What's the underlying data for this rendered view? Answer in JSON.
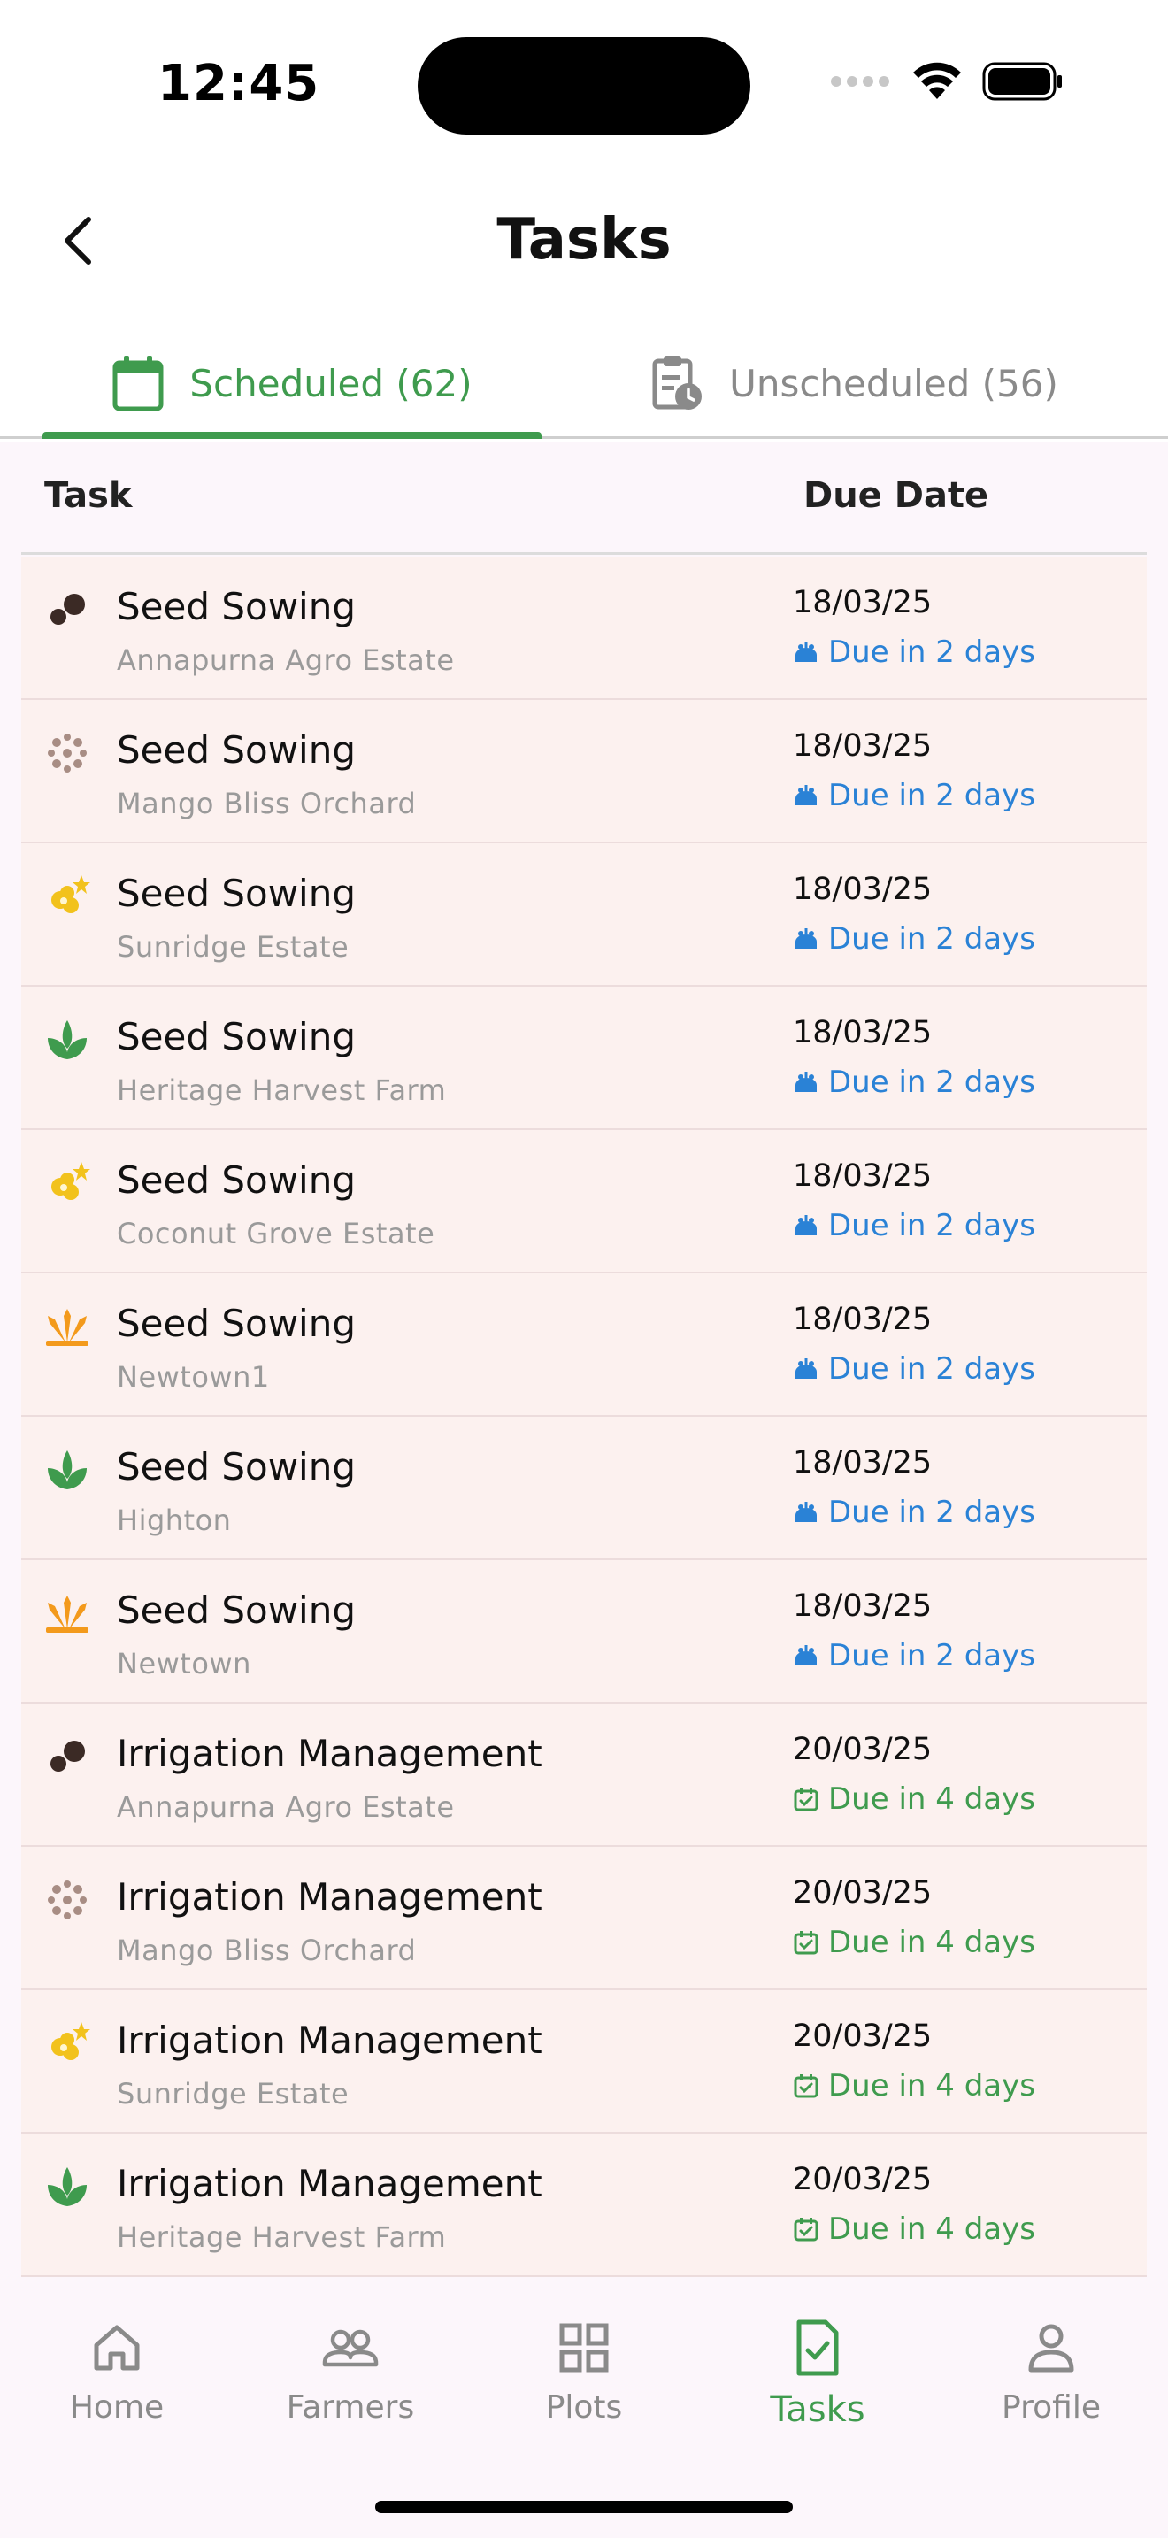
{
  "status_bar": {
    "time": "12:45"
  },
  "header": {
    "title": "Tasks"
  },
  "tabs": [
    {
      "label": "Scheduled (62)",
      "icon": "calendar-icon",
      "active": true
    },
    {
      "label": "Unscheduled (56)",
      "icon": "clipboard-clock-icon",
      "active": false
    }
  ],
  "table": {
    "col_task": "Task",
    "col_due": "Due Date",
    "rows": [
      {
        "task": "Seed Sowing",
        "farm": "Annapurna Agro Estate",
        "date": "18/03/25",
        "due": "Due in 2 days",
        "icon": "peas-icon",
        "due_icon": "sunrise-icon",
        "due_color": "#2a82d6"
      },
      {
        "task": "Seed Sowing",
        "farm": "Mango Bliss Orchard",
        "date": "18/03/25",
        "due": "Due in 2 days",
        "icon": "seeds-dots-icon",
        "due_icon": "sunrise-icon",
        "due_color": "#2a82d6"
      },
      {
        "task": "Seed Sowing",
        "farm": "Sunridge Estate",
        "date": "18/03/25",
        "due": "Due in 2 days",
        "icon": "yellow-flower-icon",
        "due_icon": "sunrise-icon",
        "due_color": "#2a82d6"
      },
      {
        "task": "Seed Sowing",
        "farm": "Heritage Harvest Farm",
        "date": "18/03/25",
        "due": "Due in 2 days",
        "icon": "green-leaf-icon",
        "due_icon": "sunrise-icon",
        "due_color": "#2a82d6"
      },
      {
        "task": "Seed Sowing",
        "farm": "Coconut Grove Estate",
        "date": "18/03/25",
        "due": "Due in 2 days",
        "icon": "yellow-flower-icon",
        "due_icon": "sunrise-icon",
        "due_color": "#2a82d6"
      },
      {
        "task": "Seed Sowing",
        "farm": "Newtown1",
        "date": "18/03/25",
        "due": "Due in 2 days",
        "icon": "wheat-sprout-icon",
        "due_icon": "sunrise-icon",
        "due_color": "#2a82d6"
      },
      {
        "task": "Seed Sowing",
        "farm": "Highton",
        "date": "18/03/25",
        "due": "Due in 2 days",
        "icon": "green-leaf-icon",
        "due_icon": "sunrise-icon",
        "due_color": "#2a82d6"
      },
      {
        "task": "Seed Sowing",
        "farm": "Newtown",
        "date": "18/03/25",
        "due": "Due in 2 days",
        "icon": "wheat-sprout-icon",
        "due_icon": "sunrise-icon",
        "due_color": "#2a82d6"
      },
      {
        "task": "Irrigation Management",
        "farm": "Annapurna Agro Estate",
        "date": "20/03/25",
        "due": "Due in 4 days",
        "icon": "peas-icon",
        "due_icon": "calendar-check-icon",
        "due_color": "#3f9b4e"
      },
      {
        "task": "Irrigation Management",
        "farm": "Mango Bliss Orchard",
        "date": "20/03/25",
        "due": "Due in 4 days",
        "icon": "seeds-dots-icon",
        "due_icon": "calendar-check-icon",
        "due_color": "#3f9b4e"
      },
      {
        "task": "Irrigation Management",
        "farm": "Sunridge Estate",
        "date": "20/03/25",
        "due": "Due in 4 days",
        "icon": "yellow-flower-icon",
        "due_icon": "calendar-check-icon",
        "due_color": "#3f9b4e"
      },
      {
        "task": "Irrigation Management",
        "farm": "Heritage Harvest Farm",
        "date": "20/03/25",
        "due": "Due in 4 days",
        "icon": "green-leaf-icon",
        "due_icon": "calendar-check-icon",
        "due_color": "#3f9b4e"
      }
    ]
  },
  "nav": [
    {
      "label": "Home",
      "icon": "home-icon",
      "active": false
    },
    {
      "label": "Farmers",
      "icon": "people-icon",
      "active": false
    },
    {
      "label": "Plots",
      "icon": "grid-icon",
      "active": false
    },
    {
      "label": "Tasks",
      "icon": "task-document-icon",
      "active": true
    },
    {
      "label": "Profile",
      "icon": "person-icon",
      "active": false
    }
  ],
  "colors": {
    "accent": "#3f9b4e",
    "due_soon": "#2a82d6",
    "muted": "#8a8a8a"
  }
}
